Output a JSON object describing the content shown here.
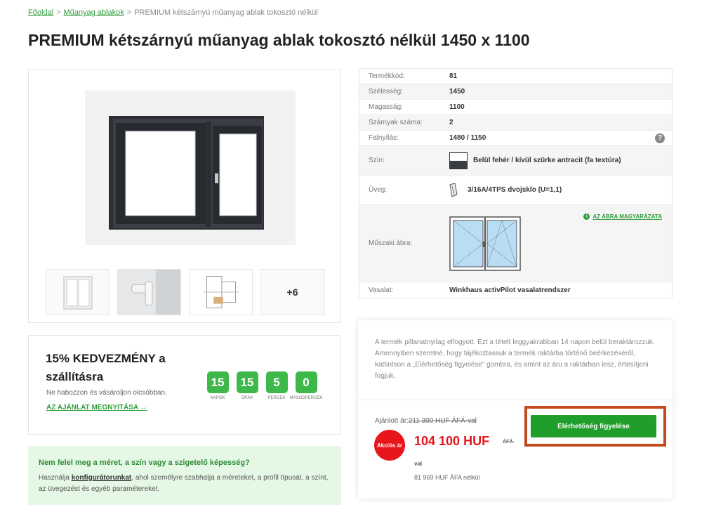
{
  "breadcrumb": {
    "home": "Főoldal",
    "category": "Műanyag ablakok",
    "current": "PREMIUM kétszárnyú műanyag ablak tokosztó nélkül"
  },
  "page_title": "PREMIUM kétszárnyú műanyag ablak tokosztó nélkül 1450 x 1100",
  "gallery": {
    "more_label": "+6"
  },
  "specs": [
    {
      "label": "Termékkód:",
      "value": "81"
    },
    {
      "label": "Szélesség:",
      "value": "1450"
    },
    {
      "label": "Magasság:",
      "value": "1100"
    },
    {
      "label": "Szárnyak száma:",
      "value": "2"
    },
    {
      "label": "Falnyílás:",
      "value": "1480 / 1150"
    },
    {
      "label": "Szín:",
      "value": "Belül fehér / kívül szürke antracit (fa textúra)"
    },
    {
      "label": "Üveg:",
      "value": "3/16A/4TPS dvojsklo (U=1,1)"
    },
    {
      "label": "Műszaki ábra:",
      "value": ""
    },
    {
      "label": "Vasalat:",
      "value": "Winkhaus activPilot vasalatrendszer"
    }
  ],
  "abra_link": "AZ ÁBRA MAGYARÁZATA",
  "help_glyph": "?",
  "discount": {
    "title": "15% KEDVEZMÉNY a szállításra",
    "subtitle": "Ne habozzon és vásároljon olcsóbban.",
    "link": "AZ AJÁNLAT MEGNYITÁSA →",
    "countdown": [
      {
        "value": "15",
        "label": "NAPOK"
      },
      {
        "value": "15",
        "label": "ÓRÁK"
      },
      {
        "value": "5",
        "label": "PERCEK"
      },
      {
        "value": "0",
        "label": "MÁSODPERCEK"
      }
    ]
  },
  "config": {
    "title": "Nem felel meg a méret, a szín vagy a szigetelő képesség?",
    "text_before": "Használja ",
    "text_link": "konfigurátorunkat",
    "text_after": ", ahol személyre szabhatja a méreteket, a profil típusát, a színt, az üvegezést és egyéb paramétereket."
  },
  "availability": {
    "text": "A termék pillanatnyilag elfogyott. Ezt a tételt leggyakrabban 14 napon belül beraktározzuk. Amennyiben szeretné, hogy tájékoztassuk a termék raktárba történő beérkezéséről, kattintson a „Elérhetőség figyelése” gombra, és amint az áru a raktárban lesz, értesítjeni fogjuk.",
    "offer_label": "Ajánlott ár:",
    "old_price": "211 300 HUF ÁFÁ-val",
    "sale_badge": "Akciós ár",
    "price": "104 100 HUF",
    "price_suffix_1": "ÁFÁ-",
    "price_suffix_2": "val",
    "net_price": "81 969 HUF ÁFA nélkül",
    "notify_button": "Elérhetőség figyelése"
  },
  "colors": {
    "accent_green": "#2e9d3a",
    "button_green": "#1f9e2c",
    "price_red": "#e5151c",
    "highlight_border": "#c44a1e"
  }
}
